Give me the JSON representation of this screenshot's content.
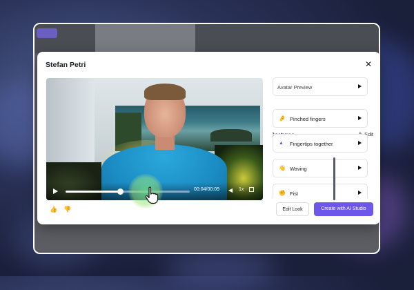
{
  "modal": {
    "title": "Stefan Petri",
    "close_icon": "close-icon"
  },
  "video": {
    "time": "00:04/00:09",
    "speed": "1x",
    "progress_fraction": 0.44,
    "icons": [
      "play-icon",
      "volume-icon",
      "fullscreen-icon"
    ]
  },
  "sidebar": {
    "preview_label": "Avatar Preview",
    "gestures_heading": "Gestures",
    "edit_label": "Edit",
    "gestures": [
      {
        "label": "Pinched fingers",
        "icon": "pinched-fingers-icon",
        "glyph": "🤌"
      },
      {
        "label": "Fingertips together",
        "icon": "fingertips-together-icon",
        "glyph": "▲"
      },
      {
        "label": "Waving",
        "icon": "waving-hand-icon",
        "glyph": "👋"
      },
      {
        "label": "Fist",
        "icon": "fist-icon",
        "glyph": "✊"
      }
    ]
  },
  "footer": {
    "thumbs_up_icon": "thumbs-up-icon",
    "thumbs_down_icon": "thumbs-down-icon",
    "edit_look_label": "Edit Look",
    "create_label": "Create with AI Studio"
  },
  "colors": {
    "accent": "#6e56e8",
    "shirt": "#1b8cc4",
    "click_ripple": "#8fe08a"
  }
}
